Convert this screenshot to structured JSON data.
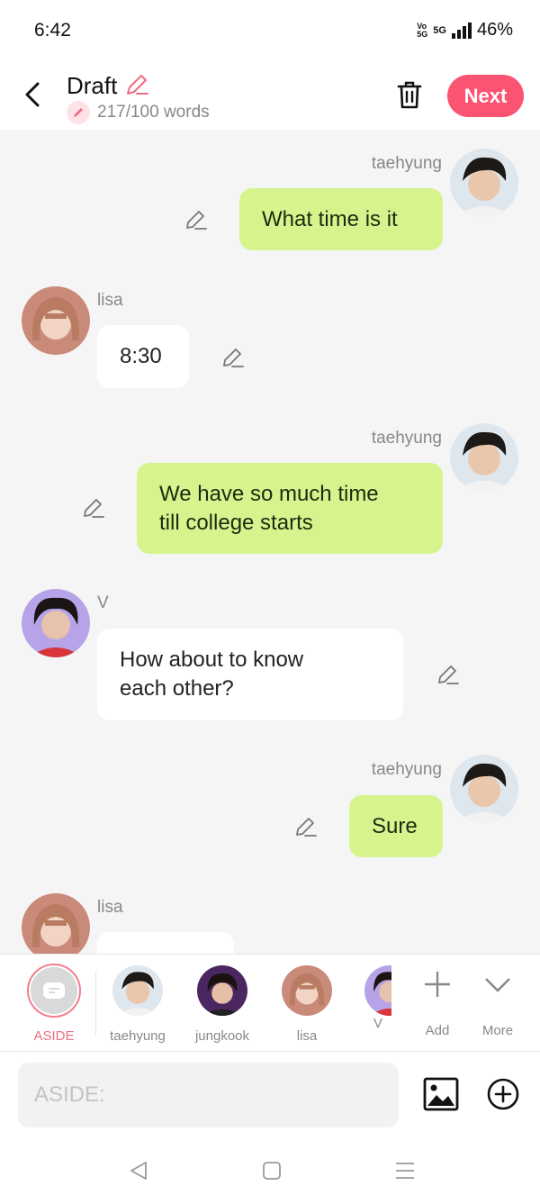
{
  "status_bar": {
    "time": "6:42",
    "volte": "Vo\n5G",
    "network": "5G",
    "battery": "46%"
  },
  "header": {
    "title": "Draft",
    "word_count": "217/100 words",
    "next_label": "Next"
  },
  "messages": [
    {
      "sender": "taehyung",
      "side": "right",
      "text": "What time is it"
    },
    {
      "sender": "lisa",
      "side": "left",
      "text": "8:30"
    },
    {
      "sender": "taehyung",
      "side": "right",
      "text": "We have so much time\ntill college starts"
    },
    {
      "sender": "V",
      "side": "left",
      "text": "How about to know\neach other?"
    },
    {
      "sender": "taehyung",
      "side": "right",
      "text": "Sure"
    },
    {
      "sender": "lisa",
      "side": "left",
      "text": ""
    }
  ],
  "characters": [
    {
      "name": "ASIDE"
    },
    {
      "name": "taehyung"
    },
    {
      "name": "jungkook"
    },
    {
      "name": "lisa"
    },
    {
      "name": "V"
    }
  ],
  "tools": {
    "add_label": "Add",
    "more_label": "More"
  },
  "input": {
    "placeholder": "ASIDE:"
  },
  "colors": {
    "accent": "#fb5372",
    "my_bubble": "#d6f48d",
    "their_bubble": "#ffffff",
    "background": "#f5f5f5"
  }
}
